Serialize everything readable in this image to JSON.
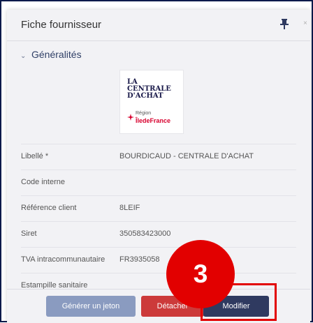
{
  "header": {
    "title": "Fiche fournisseur",
    "close": "×"
  },
  "section": {
    "label": "Généralités"
  },
  "logo": {
    "line1": "LA",
    "line2": "CENTRALE",
    "line3": "D'ACHAT",
    "region_small": "Région",
    "region_big": "ÎledeFrance"
  },
  "fields": [
    {
      "label": "Libellé *",
      "value": "BOURDICAUD - CENTRALE D'ACHAT"
    },
    {
      "label": "Code interne",
      "value": ""
    },
    {
      "label": "Référence client",
      "value": "8LEIF"
    },
    {
      "label": "Siret",
      "value": "350583423000"
    },
    {
      "label": "TVA intracommunautaire",
      "value": "FR3935058"
    },
    {
      "label": "Estampille sanitaire",
      "value": ""
    }
  ],
  "buttons": {
    "generate": "Générer un jeton",
    "detach": "Détacher",
    "modify": "Modifier"
  },
  "annotation": {
    "step": "3"
  },
  "colors": {
    "accent": "#2f3a60",
    "danger": "#cc3a3a",
    "muted": "#8a9bc0",
    "highlight": "#e20000"
  }
}
